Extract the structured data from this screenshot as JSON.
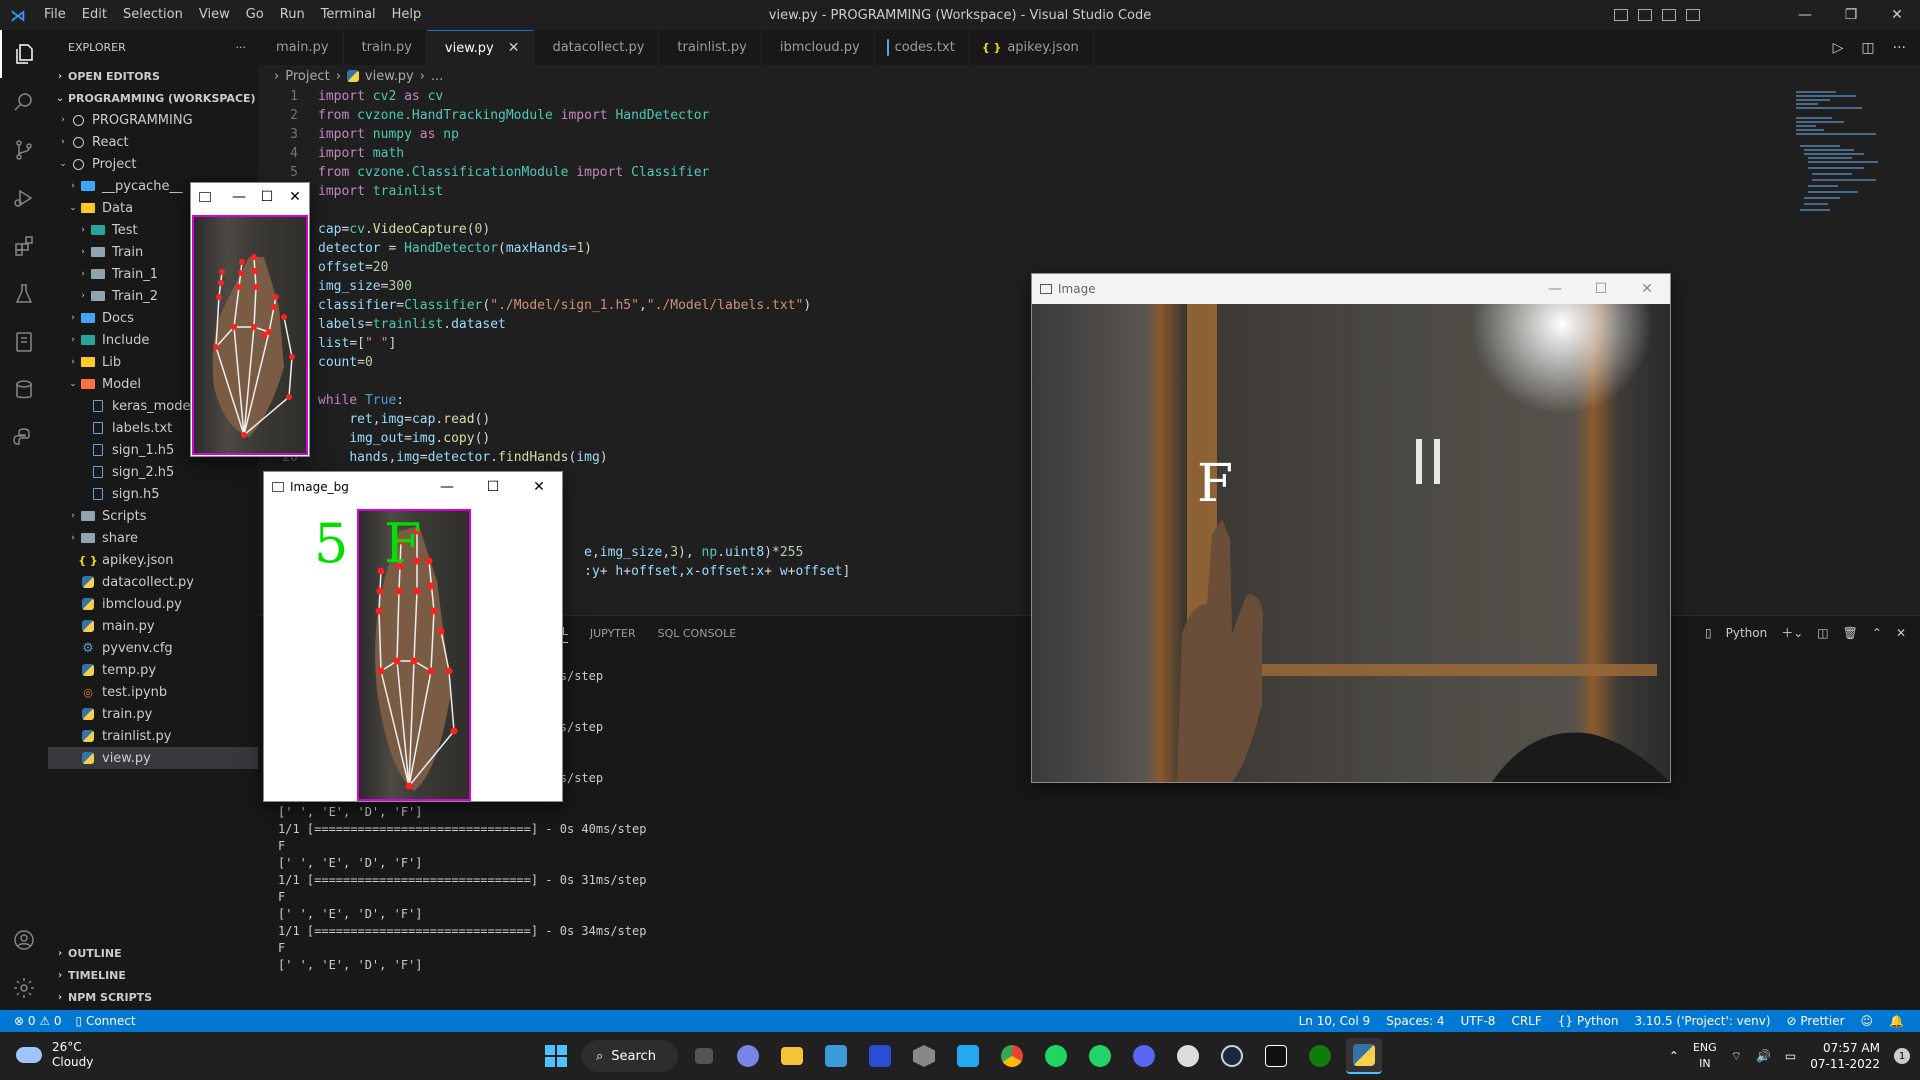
{
  "titlebar": {
    "title": "view.py - PROGRAMMING (Workspace) - Visual Studio Code",
    "menu": [
      "File",
      "Edit",
      "Selection",
      "View",
      "Go",
      "Run",
      "Terminal",
      "Help"
    ]
  },
  "sidebar": {
    "header": "EXPLORER",
    "open_editors": "OPEN EDITORS",
    "workspace": "PROGRAMMING (WORKSPACE)",
    "tree": [
      {
        "label": "PROGRAMMING",
        "depth": 0,
        "chev": ">",
        "icon": "circle"
      },
      {
        "label": "React",
        "depth": 0,
        "chev": ">",
        "icon": "circle"
      },
      {
        "label": "Project",
        "depth": 0,
        "chev": "v",
        "icon": "circle"
      },
      {
        "label": "__pycache__",
        "depth": 1,
        "chev": ">",
        "icon": "folder-blue"
      },
      {
        "label": "Data",
        "depth": 1,
        "chev": "v",
        "icon": "folder-yellow"
      },
      {
        "label": "Test",
        "depth": 2,
        "chev": ">",
        "icon": "folder-teal"
      },
      {
        "label": "Train",
        "depth": 2,
        "chev": ">",
        "icon": "folder"
      },
      {
        "label": "Train_1",
        "depth": 2,
        "chev": ">",
        "icon": "folder"
      },
      {
        "label": "Train_2",
        "depth": 2,
        "chev": ">",
        "icon": "folder"
      },
      {
        "label": "Docs",
        "depth": 1,
        "chev": ">",
        "icon": "folder-blue"
      },
      {
        "label": "Include",
        "depth": 1,
        "chev": ">",
        "icon": "folder-teal"
      },
      {
        "label": "Lib",
        "depth": 1,
        "chev": ">",
        "icon": "folder-yellow"
      },
      {
        "label": "Model",
        "depth": 1,
        "chev": "v",
        "icon": "folder-orange"
      },
      {
        "label": "keras_model.h5",
        "depth": 2,
        "chev": "",
        "icon": "txt"
      },
      {
        "label": "labels.txt",
        "depth": 2,
        "chev": "",
        "icon": "txt"
      },
      {
        "label": "sign_1.h5",
        "depth": 2,
        "chev": "",
        "icon": "txt"
      },
      {
        "label": "sign_2.h5",
        "depth": 2,
        "chev": "",
        "icon": "txt"
      },
      {
        "label": "sign.h5",
        "depth": 2,
        "chev": "",
        "icon": "txt"
      },
      {
        "label": "Scripts",
        "depth": 1,
        "chev": ">",
        "icon": "folder"
      },
      {
        "label": "share",
        "depth": 1,
        "chev": ">",
        "icon": "folder"
      },
      {
        "label": "apikey.json",
        "depth": 1,
        "chev": "",
        "icon": "json"
      },
      {
        "label": "datacollect.py",
        "depth": 1,
        "chev": "",
        "icon": "py"
      },
      {
        "label": "ibmcloud.py",
        "depth": 1,
        "chev": "",
        "icon": "py"
      },
      {
        "label": "main.py",
        "depth": 1,
        "chev": "",
        "icon": "py"
      },
      {
        "label": "pyvenv.cfg",
        "depth": 1,
        "chev": "",
        "icon": "cfg"
      },
      {
        "label": "temp.py",
        "depth": 1,
        "chev": "",
        "icon": "py"
      },
      {
        "label": "test.ipynb",
        "depth": 1,
        "chev": "",
        "icon": "nb"
      },
      {
        "label": "train.py",
        "depth": 1,
        "chev": "",
        "icon": "py"
      },
      {
        "label": "trainlist.py",
        "depth": 1,
        "chev": "",
        "icon": "py"
      },
      {
        "label": "view.py",
        "depth": 1,
        "chev": "",
        "icon": "py",
        "selected": true
      }
    ],
    "outline": "OUTLINE",
    "timeline": "TIMELINE",
    "npm_scripts": "NPM SCRIPTS"
  },
  "tabs": [
    {
      "label": "main.py",
      "icon": "py"
    },
    {
      "label": "train.py",
      "icon": "py"
    },
    {
      "label": "view.py",
      "icon": "py",
      "active": true
    },
    {
      "label": "datacollect.py",
      "icon": "py"
    },
    {
      "label": "trainlist.py",
      "icon": "py"
    },
    {
      "label": "ibmcloud.py",
      "icon": "py"
    },
    {
      "label": "codes.txt",
      "icon": "txt"
    },
    {
      "label": "apikey.json",
      "icon": "json"
    }
  ],
  "breadcrumb": {
    "folder": "Project",
    "file": "view.py",
    "rest": "..."
  },
  "code": [
    {
      "n": "1",
      "t": [
        [
          "kw",
          "import"
        ],
        [
          "pl",
          " "
        ],
        [
          "mod",
          "cv2"
        ],
        [
          "pl",
          " "
        ],
        [
          "kw",
          "as"
        ],
        [
          "pl",
          " "
        ],
        [
          "mod",
          "cv"
        ]
      ]
    },
    {
      "n": "2",
      "t": [
        [
          "kw",
          "from"
        ],
        [
          "pl",
          " "
        ],
        [
          "mod",
          "cvzone.HandTrackingModule"
        ],
        [
          "pl",
          " "
        ],
        [
          "kw",
          "import"
        ],
        [
          "pl",
          " "
        ],
        [
          "mod",
          "HandDetector"
        ]
      ]
    },
    {
      "n": "3",
      "t": [
        [
          "kw",
          "import"
        ],
        [
          "pl",
          " "
        ],
        [
          "mod",
          "numpy"
        ],
        [
          "pl",
          " "
        ],
        [
          "kw",
          "as"
        ],
        [
          "pl",
          " "
        ],
        [
          "mod",
          "np"
        ]
      ]
    },
    {
      "n": "4",
      "t": [
        [
          "kw",
          "import"
        ],
        [
          "pl",
          " "
        ],
        [
          "mod",
          "math"
        ]
      ]
    },
    {
      "n": "5",
      "t": [
        [
          "kw",
          "from"
        ],
        [
          "pl",
          " "
        ],
        [
          "mod",
          "cvzone.ClassificationModule"
        ],
        [
          "pl",
          " "
        ],
        [
          "kw",
          "import"
        ],
        [
          "pl",
          " "
        ],
        [
          "mod",
          "Classifier"
        ]
      ]
    },
    {
      "n": "",
      "t": [
        [
          "kw",
          "import"
        ],
        [
          "pl",
          " "
        ],
        [
          "mod",
          "trainlist"
        ]
      ]
    },
    {
      "n": "",
      "t": []
    },
    {
      "n": "",
      "t": [
        [
          "var",
          "cap"
        ],
        [
          "pl",
          "="
        ],
        [
          "mod",
          "cv"
        ],
        [
          "pl",
          "."
        ],
        [
          "fn",
          "VideoCapture"
        ],
        [
          "pl",
          "("
        ],
        [
          "num",
          "0"
        ],
        [
          "pl",
          ")"
        ]
      ]
    },
    {
      "n": "",
      "t": [
        [
          "var",
          "detector"
        ],
        [
          "pl",
          " = "
        ],
        [
          "mod",
          "HandDetector"
        ],
        [
          "pl",
          "("
        ],
        [
          "var",
          "maxHands"
        ],
        [
          "pl",
          "="
        ],
        [
          "num",
          "1"
        ],
        [
          "pl",
          ")"
        ]
      ]
    },
    {
      "n": "",
      "t": [
        [
          "var",
          "offset"
        ],
        [
          "pl",
          "="
        ],
        [
          "num",
          "20"
        ]
      ]
    },
    {
      "n": "",
      "t": [
        [
          "var",
          "img_size"
        ],
        [
          "pl",
          "="
        ],
        [
          "num",
          "300"
        ]
      ]
    },
    {
      "n": "",
      "t": [
        [
          "var",
          "classifier"
        ],
        [
          "pl",
          "="
        ],
        [
          "mod",
          "Classifier"
        ],
        [
          "pl",
          "("
        ],
        [
          "str",
          "\"./Model/sign_1.h5\""
        ],
        [
          "pl",
          ","
        ],
        [
          "str",
          "\"./Model/labels.txt\""
        ],
        [
          "pl",
          ")"
        ]
      ]
    },
    {
      "n": "",
      "t": [
        [
          "var",
          "labels"
        ],
        [
          "pl",
          "="
        ],
        [
          "mod",
          "trainlist"
        ],
        [
          "pl",
          "."
        ],
        [
          "var",
          "dataset"
        ]
      ]
    },
    {
      "n": "",
      "t": [
        [
          "var",
          "list"
        ],
        [
          "pl",
          "=["
        ],
        [
          "str",
          "\" \""
        ],
        [
          "pl",
          "]"
        ]
      ]
    },
    {
      "n": "",
      "t": [
        [
          "var",
          "count"
        ],
        [
          "pl",
          "="
        ],
        [
          "num",
          "0"
        ]
      ]
    },
    {
      "n": "",
      "t": []
    },
    {
      "n": "",
      "t": [
        [
          "kw",
          "while"
        ],
        [
          "pl",
          " "
        ],
        [
          "kwb",
          "True"
        ],
        [
          "pl",
          ":"
        ]
      ]
    },
    {
      "n": "",
      "t": [
        [
          "pl",
          "    "
        ],
        [
          "var",
          "ret"
        ],
        [
          "pl",
          ","
        ],
        [
          "var",
          "img"
        ],
        [
          "pl",
          "="
        ],
        [
          "var",
          "cap"
        ],
        [
          "pl",
          "."
        ],
        [
          "fn",
          "read"
        ],
        [
          "pl",
          "()"
        ]
      ]
    },
    {
      "n": "",
      "t": [
        [
          "pl",
          "    "
        ],
        [
          "var",
          "img_out"
        ],
        [
          "pl",
          "="
        ],
        [
          "var",
          "img"
        ],
        [
          "pl",
          "."
        ],
        [
          "fn",
          "copy"
        ],
        [
          "pl",
          "()"
        ]
      ]
    },
    {
      "n": "20",
      "t": [
        [
          "pl",
          "    "
        ],
        [
          "var",
          "hands"
        ],
        [
          "pl",
          ","
        ],
        [
          "var",
          "img"
        ],
        [
          "pl",
          "="
        ],
        [
          "var",
          "detector"
        ],
        [
          "pl",
          "."
        ],
        [
          "fn",
          "findHands"
        ],
        [
          "pl",
          "("
        ],
        [
          "var",
          "img"
        ],
        [
          "pl",
          ")"
        ]
      ]
    },
    {
      "n": "",
      "t": []
    },
    {
      "n": "",
      "t": []
    },
    {
      "n": "",
      "t": []
    },
    {
      "n": "",
      "t": []
    },
    {
      "n": "",
      "t": [
        [
          "pl",
          "                                  "
        ],
        [
          "var",
          "e"
        ],
        [
          "pl",
          ","
        ],
        [
          "var",
          "img_size"
        ],
        [
          "pl",
          ","
        ],
        [
          "num",
          "3"
        ],
        [
          "pl",
          "), "
        ],
        [
          "mod",
          "np"
        ],
        [
          "pl",
          "."
        ],
        [
          "var",
          "uint8"
        ],
        [
          "pl",
          ")*"
        ],
        [
          "num",
          "255"
        ]
      ]
    },
    {
      "n": "",
      "t": [
        [
          "pl",
          "                                  :"
        ],
        [
          "var",
          "y"
        ],
        [
          "pl",
          "+ "
        ],
        [
          "var",
          "h"
        ],
        [
          "pl",
          "+"
        ],
        [
          "var",
          "offset"
        ],
        [
          "pl",
          ","
        ],
        [
          "var",
          "x"
        ],
        [
          "pl",
          "-"
        ],
        [
          "var",
          "offset"
        ],
        [
          "pl",
          ":"
        ],
        [
          "var",
          "x"
        ],
        [
          "pl",
          "+ "
        ],
        [
          "var",
          "w"
        ],
        [
          "pl",
          "+"
        ],
        [
          "var",
          "offset"
        ],
        [
          "pl",
          "]"
        ]
      ]
    }
  ],
  "panel": {
    "tabs": [
      "NAL",
      "JUPYTER",
      "SQL CONSOLE"
    ],
    "shell": "Python",
    "lines": [
      "",
      "                                  s 64ms/step",
      "",
      "",
      "                                  s 56ms/step",
      "",
      "",
      "                                  s 56ms/step",
      "F",
      "[' ', 'E', 'D', 'F']",
      "1/1 [==============================] - 0s 40ms/step",
      "F",
      "[' ', 'E', 'D', 'F']",
      "1/1 [==============================] - 0s 31ms/step",
      "F",
      "[' ', 'E', 'D', 'F']",
      "1/1 [==============================] - 0s 34ms/step",
      "F",
      "[' ', 'E', 'D', 'F']"
    ]
  },
  "statusbar": {
    "errors": "⊗ 0 ⚠ 0",
    "connect": "Connect",
    "position": "Ln 10, Col 9",
    "spaces": "Spaces: 4",
    "encoding": "UTF-8",
    "eol": "CRLF",
    "language": "Python",
    "interpreter": "3.10.5 ('Project': venv)",
    "prettier": "Prettier"
  },
  "windows": {
    "crop": {
      "title": ""
    },
    "image_bg": {
      "title": "Image_bg",
      "count": "5",
      "letter": "F"
    },
    "image": {
      "title": "Image",
      "letter": "F"
    }
  },
  "taskbar": {
    "temp": "26°C",
    "weather": "Cloudy",
    "search": "Search",
    "lang1": "ENG",
    "lang2": "IN",
    "time": "07:57 AM",
    "date": "07-11-2022"
  }
}
